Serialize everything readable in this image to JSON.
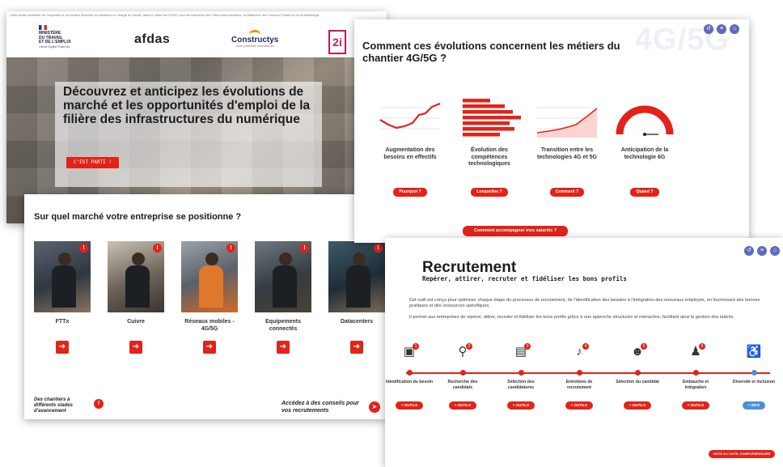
{
  "landing": {
    "funding_note": "Cette action bénéficie de l'expertise et du soutien financier du ministère en charge du travail, dans le cadre de l'EDEC pour les branches des Télécommunications, du Bâtiment, des Travaux Publics et de la Métallurgie",
    "logos": {
      "ministry_lines": [
        "MINISTÈRE",
        "DU TRAVAIL",
        "ET DE L'EMPLOI"
      ],
      "ministry_motto": "Liberté Égalité Fraternité",
      "afdas": "afdas",
      "constructys": "Constructys",
      "constructys_tagline": "Votre partenaire compétences",
      "brand_2i": "2i"
    },
    "hero_title": "Découvrez et anticipez les évolutions de marché et les opportunités d'emploi de la filière des infrastructures du numérique",
    "cta_label": "C'EST PARTI !"
  },
  "evolutions": {
    "bg_word": "4G/5G",
    "title": "Comment ces évolutions concernent les métiers du chantier 4G/5G ?",
    "nav_icons": [
      "back-icon",
      "menu-icon",
      "home-icon"
    ],
    "cards": [
      {
        "caption": "Augmentation des besoins en effectifs",
        "button": "Pourquoi ?",
        "viz": "line-chart"
      },
      {
        "caption": "Évolution des compétences technologiques",
        "button": "Lesquelles ?",
        "viz": "bar-chart"
      },
      {
        "caption": "Transition entre les technologies 4G et 5G",
        "button": "Comment ?",
        "viz": "area-chart"
      },
      {
        "caption": "Anticipation de la technologie 6G",
        "button": "Quand ?",
        "viz": "gauge"
      }
    ],
    "bottom_button": "Comment accompagner mes salariés ?"
  },
  "market": {
    "title": "Sur quel marché votre entreprise se positionne ?",
    "badge": "!",
    "cards": [
      {
        "label": "FTTx"
      },
      {
        "label": "Cuivre"
      },
      {
        "label": "Réseaux mobiles - 4G/5G"
      },
      {
        "label": "Equipements connectés"
      },
      {
        "label": "Datacenters"
      }
    ],
    "arrow_glyph": "➔",
    "footer_left": "Des chantiers à différents stades d'avancement",
    "footer_left_badge": "!",
    "footer_right": "Accédez à des conseils pour vos recrutements"
  },
  "recruitment": {
    "title": "Recrutement",
    "subtitle": "Repérer, attirer, recruter et fidéliser les bons profils",
    "paragraph1": "Cet outil est conçu pour optimiser chaque étape du processus de recrutement, de l'identification des besoins à l'intégration des nouveaux employés, en fournissant des bonnes pratiques et des ressources spécifiques.",
    "paragraph2": "Il permet aux entreprises de repérer, attirer, recruter et fidéliser les bons profils grâce à une approche structurée et interactive, facilitant ainsi la gestion des talents.",
    "steps": [
      {
        "label": "Identification du besoin",
        "button": "+ OUTILS",
        "icon": "id-card-icon",
        "num": "1"
      },
      {
        "label": "Recherche des candidats",
        "button": "+ OUTILS",
        "icon": "search-person-icon",
        "num": "2"
      },
      {
        "label": "Sélection des candidatures",
        "button": "+ OUTILS",
        "icon": "documents-icon",
        "num": "3"
      },
      {
        "label": "Entretiens de recrutement",
        "button": "+ OUTILS",
        "icon": "microphone-icon",
        "num": "4"
      },
      {
        "label": "Sélection du candidat",
        "button": "+ OUTILS",
        "icon": "head-icon",
        "num": "5"
      },
      {
        "label": "Embauche et intégration",
        "button": "+ OUTILS",
        "icon": "handshake-icon",
        "num": "6"
      },
      {
        "label": "Diversité et inclusion",
        "button": "+ INFO",
        "icon": "wheelchair-icon",
        "num": ""
      }
    ],
    "corner_button": "NOTE À L'OUTIL COMPLÉMENTAIRE"
  },
  "colors": {
    "accent": "#e2231a",
    "info": "#4a90d9",
    "nav": "#5c6bc0"
  }
}
